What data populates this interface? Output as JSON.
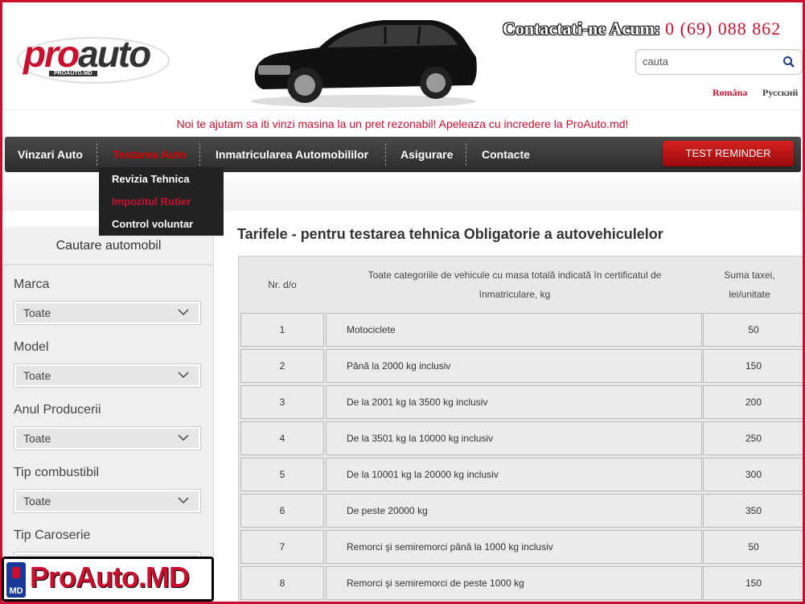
{
  "header": {
    "logo_main": "pro",
    "logo_accent": "auto",
    "logo_sub": "PROAUTO.MD",
    "contact_label": "Contactati-ne Acum:",
    "contact_phone": "0 (69) 088 862",
    "search_placeholder": "cauta",
    "lang_ro": "Româna",
    "lang_ru": "Русский"
  },
  "tagline": "Noi te ajutam sa iti vinzi masina la un pret rezonabil! Apeleaza cu incredere la ProAuto.md!",
  "nav": {
    "items": [
      "Vinzari Auto",
      "Testarea Auto",
      "Inmatricularea Automobililor",
      "Asigurare",
      "Contacte"
    ],
    "active_index": 1,
    "button": "TEST REMINDER",
    "dropdown": [
      "Revizia Tehnica",
      "Impozitul Rutier",
      "Control voluntar"
    ]
  },
  "sidebar": {
    "title": "Cautare automobil",
    "filters": [
      {
        "label": "Marca",
        "value": "Toate"
      },
      {
        "label": "Model",
        "value": "Toate"
      },
      {
        "label": "Anul Producerii",
        "value": "Toate"
      },
      {
        "label": "Tip combustibil",
        "value": "Toate"
      },
      {
        "label": "Tip Caroserie",
        "value": ""
      }
    ]
  },
  "content": {
    "title": "Tarifele - pentru testarea tehnica Obligatorie a autovehiculelor",
    "table": {
      "headers": [
        "Nr. d/o",
        "Toate categoriile de vehicule cu masa totală indicată în certificatul de înmatriculare, kg",
        "Suma taxei, lei/unitate"
      ],
      "rows": [
        [
          "1",
          "Motociclete",
          "50"
        ],
        [
          "2",
          "Până la 2000 kg inclusiv",
          "150"
        ],
        [
          "3",
          "De la 2001 kg la 3500 kg inclusiv",
          "200"
        ],
        [
          "4",
          "De la 3501 kg la 10000 kg inclusiv",
          "250"
        ],
        [
          "5",
          "De la 10001 kg la 20000 kg inclusiv",
          "300"
        ],
        [
          "6",
          "De peste 20000 kg",
          "350"
        ],
        [
          "7",
          "Remorci şi semiremorci până la 1000 kg inclusiv",
          "50"
        ],
        [
          "8",
          "Remorci şi semiremorci de peste 1000 kg",
          "150"
        ]
      ]
    }
  },
  "badge": {
    "flag": "MD",
    "text": "ProAuto.MD"
  },
  "colors": {
    "brand": "#c8102e",
    "nav": "#333333"
  }
}
